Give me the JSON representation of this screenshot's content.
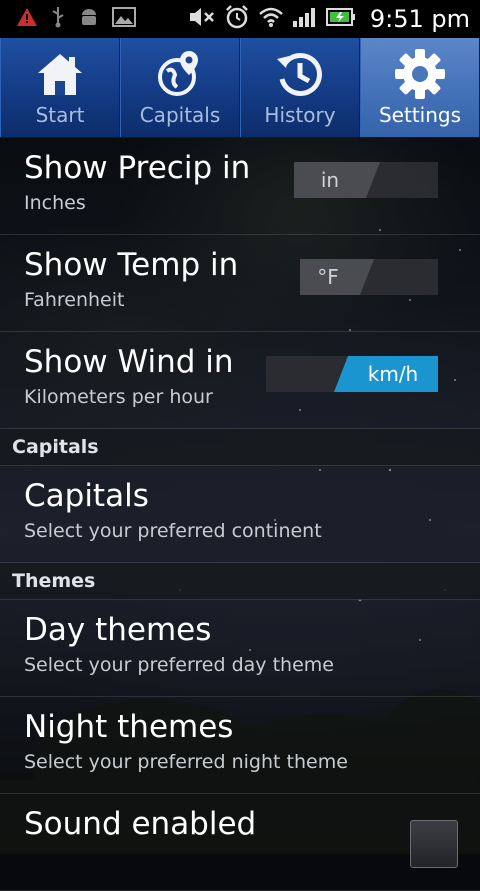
{
  "status_bar": {
    "time": "9:51 pm",
    "icons": [
      "warning-icon",
      "usb-icon",
      "android-icon",
      "image-icon",
      "mute-icon",
      "alarm-icon",
      "wifi-icon",
      "signal-icon",
      "battery-charging-icon"
    ]
  },
  "tabs": [
    {
      "label": "Start",
      "icon": "home-icon",
      "selected": false
    },
    {
      "label": "Capitals",
      "icon": "globe-pin-icon",
      "selected": false
    },
    {
      "label": "History",
      "icon": "history-icon",
      "selected": false
    },
    {
      "label": "Settings",
      "icon": "gear-icon",
      "selected": true
    }
  ],
  "settings": {
    "precip": {
      "title": "Show Precip in",
      "subtitle": "Inches",
      "toggle_value": "in"
    },
    "temp": {
      "title": "Show Temp in",
      "subtitle": "Fahrenheit",
      "toggle_value": "°F"
    },
    "wind": {
      "title": "Show Wind in",
      "subtitle": "Kilometers per hour",
      "toggle_value": "km/h"
    },
    "capitals_section": "Capitals",
    "capitals": {
      "title": "Capitals",
      "subtitle": "Select your preferred continent"
    },
    "themes_section": "Themes",
    "day_themes": {
      "title": "Day themes",
      "subtitle": "Select your preferred day theme"
    },
    "night_themes": {
      "title": "Night themes",
      "subtitle": "Select your preferred night theme"
    },
    "sound": {
      "title": "Sound enabled",
      "checked": false
    }
  },
  "colors": {
    "accent_blue": "#1b95cf",
    "tab_blue": "#143b85",
    "tab_selected": "#4472b8"
  }
}
